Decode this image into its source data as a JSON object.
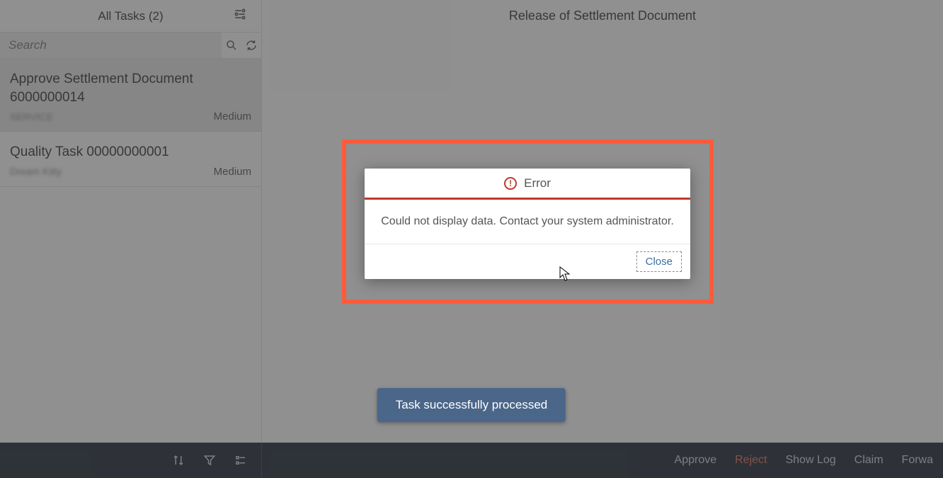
{
  "sidebar": {
    "title": "All Tasks (2)",
    "search_placeholder": "Search"
  },
  "tasks": [
    {
      "title": "Approve Settlement Document 6000000014",
      "subtitle": "SERVICE",
      "priority": "Medium"
    },
    {
      "title": "Quality Task 00000000001",
      "subtitle": "Dream Kitty",
      "priority": "Medium"
    }
  ],
  "main": {
    "header_title": "Release of Settlement Document"
  },
  "dialog": {
    "title": "Error",
    "message": "Could not display data. Contact your system administrator.",
    "close_label": "Close"
  },
  "toast": {
    "message": "Task successfully processed"
  },
  "footer": {
    "actions": {
      "approve": "Approve",
      "reject": "Reject",
      "show_log": "Show Log",
      "claim": "Claim",
      "forward": "Forwa"
    }
  }
}
